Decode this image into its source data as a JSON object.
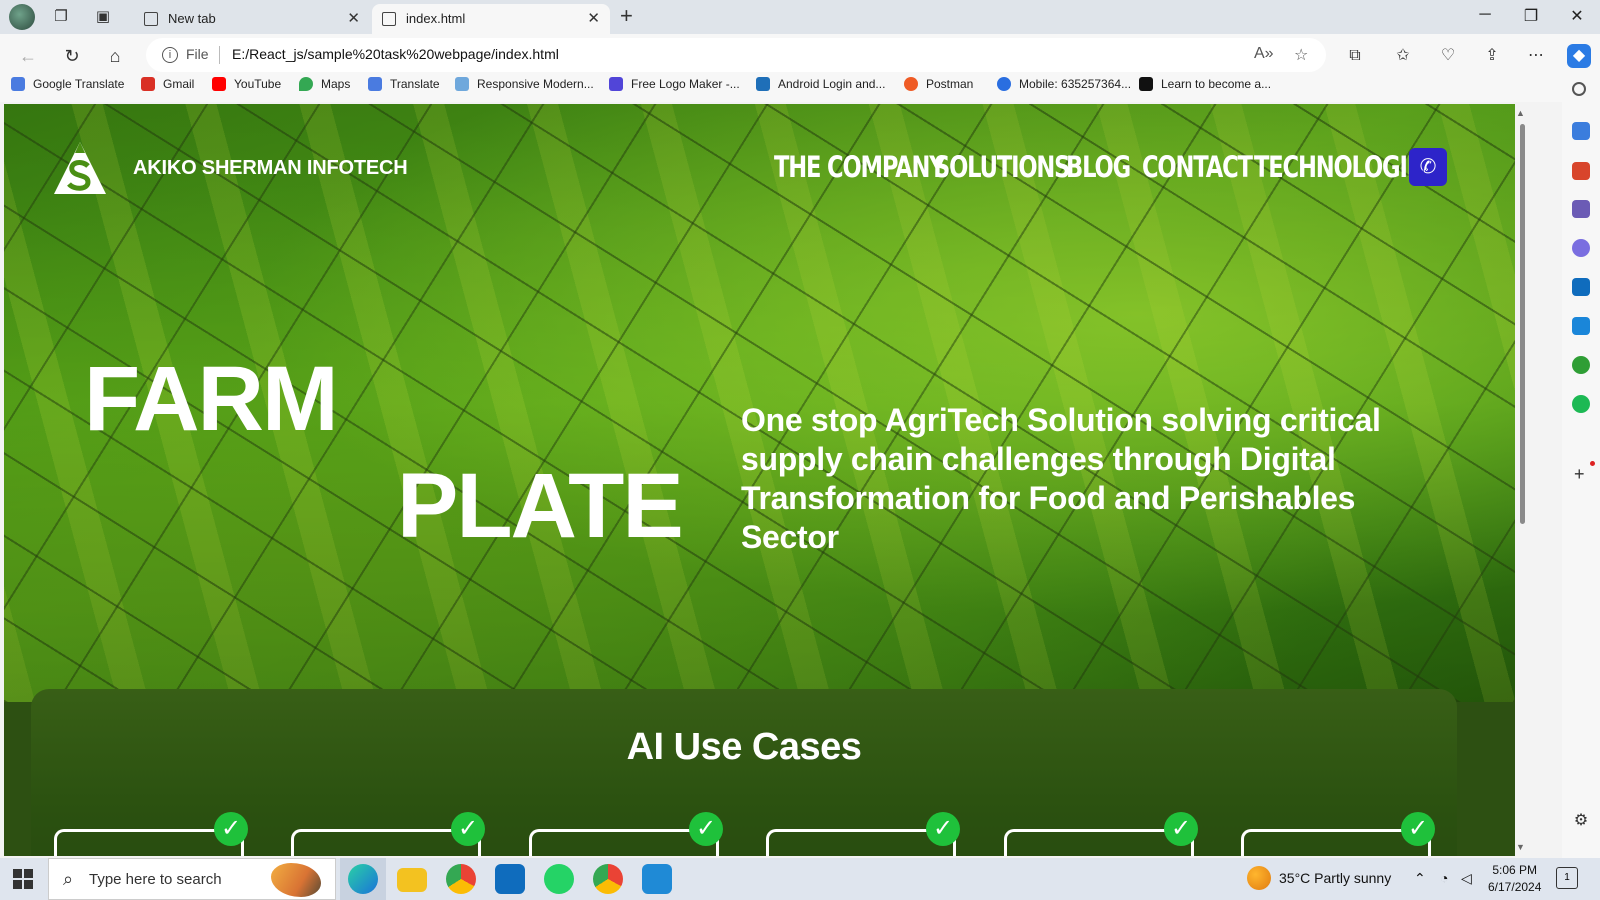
{
  "browser": {
    "tabs": [
      {
        "label": "New tab"
      },
      {
        "label": "index.html"
      }
    ],
    "address": {
      "scheme_label": "File",
      "url": "E:/React_js/sample%20task%20webpage/index.html"
    },
    "bookmarks": [
      {
        "label": "Google Translate",
        "color": "#4a7be0"
      },
      {
        "label": "Gmail",
        "color": "#d93025"
      },
      {
        "label": "YouTube",
        "color": "#ff0000"
      },
      {
        "label": "Maps",
        "color": "#34a853"
      },
      {
        "label": "Translate",
        "color": "#4a7be0"
      },
      {
        "label": "Responsive Modern...",
        "color": "#6fa8dc"
      },
      {
        "label": "Free Logo Maker -...",
        "color": "#5145d8"
      },
      {
        "label": "Android Login and...",
        "color": "#1f6fb8"
      },
      {
        "label": "Postman",
        "color": "#ef5b25"
      },
      {
        "label": "Mobile: 635257364...",
        "color": "#2a6ee0"
      },
      {
        "label": "Learn to become a...",
        "color": "#111111"
      }
    ]
  },
  "site": {
    "brand": "AKIKO SHERMAN INFOTECH",
    "nav": [
      "THE COMPANY",
      "SOLUTIONS",
      "BLOG",
      "CONTACT",
      "TECHNOLOGIES"
    ],
    "phone_icon": "phone-icon",
    "accent": "#2d24c9",
    "hero": {
      "word1": "FARM",
      "word2": "PLATE",
      "tagline": "One stop AgriTech Solution solving critical supply chain challenges through Digital Transformation for Food and Perishables Sector"
    },
    "ai_section": {
      "title": "AI Use Cases",
      "card_count": 6,
      "check_color": "#1fc13b"
    }
  },
  "taskbar": {
    "search_placeholder": "Type here to search",
    "weather": "35°C  Partly sunny",
    "time": "5:06 PM",
    "date": "6/17/2024",
    "notifications": "1"
  }
}
